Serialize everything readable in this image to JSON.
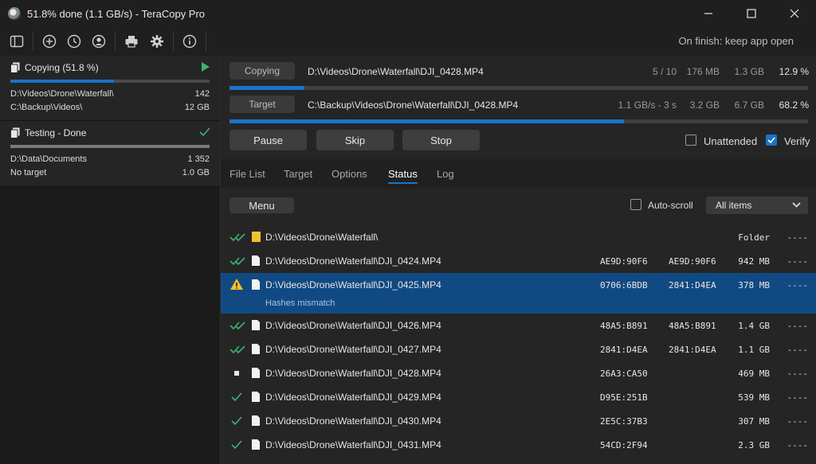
{
  "window": {
    "title": "51.8% done (1.1 GB/s) - TeraCopy Pro"
  },
  "toolbar": {
    "on_finish": "On finish: keep app open"
  },
  "jobs": [
    {
      "title": "Copying (51.8 %)",
      "progress": 0.518,
      "source": "D:\\Videos\\Drone\\Waterfall\\",
      "source_count": "142",
      "target": "C:\\Backup\\Videos\\",
      "target_size": "12 GB"
    },
    {
      "title": "Testing - Done",
      "progress": 1.0,
      "source": "D:\\Data\\Documents",
      "source_count": "1 352",
      "target": "No target",
      "target_size": "1.0 GB"
    }
  ],
  "current": {
    "copying_label": "Copying",
    "copying_path": "D:\\Videos\\Drone\\Waterfall\\DJI_0428.MP4",
    "files": "5 / 10",
    "done_size": "176 MB",
    "total_size": "1.3 GB",
    "file_percent": "12.9 %",
    "file_progress": 0.129,
    "target_label": "Target",
    "target_path": "C:\\Backup\\Videos\\Drone\\Waterfall\\DJI_0428.MP4",
    "speed": "1.1 GB/s - 3 s",
    "total_done": "3.2 GB",
    "total_all": "6.7 GB",
    "total_percent": "68.2 %",
    "total_progress": 0.682
  },
  "buttons": {
    "pause": "Pause",
    "skip": "Skip",
    "stop": "Stop"
  },
  "options": {
    "unattended": "Unattended",
    "verify": "Verify"
  },
  "tabs": [
    "File List",
    "Target",
    "Options",
    "Status",
    "Log"
  ],
  "status_bar": {
    "menu": "Menu",
    "autoscroll": "Auto-scroll",
    "filter": "All items"
  },
  "rows": [
    {
      "status": "double-check",
      "type": "folder",
      "path": "D:\\Videos\\Drone\\Waterfall\\",
      "hash1": "",
      "hash2": "",
      "size": "Folder",
      "extra": "----"
    },
    {
      "status": "double-check",
      "type": "file",
      "path": "D:\\Videos\\Drone\\Waterfall\\DJI_0424.MP4",
      "hash1": "AE9D:90F6",
      "hash2": "AE9D:90F6",
      "size": "942 MB",
      "extra": "----"
    },
    {
      "status": "warning",
      "type": "file",
      "path": "D:\\Videos\\Drone\\Waterfall\\DJI_0425.MP4",
      "hash1": "0706:6BDB",
      "hash2": "2841:D4EA",
      "size": "378 MB",
      "extra": "----",
      "note": "Hashes mismatch"
    },
    {
      "status": "double-check",
      "type": "file",
      "path": "D:\\Videos\\Drone\\Waterfall\\DJI_0426.MP4",
      "hash1": "48A5:B891",
      "hash2": "48A5:B891",
      "size": "1.4 GB",
      "extra": "----"
    },
    {
      "status": "double-check",
      "type": "file",
      "path": "D:\\Videos\\Drone\\Waterfall\\DJI_0427.MP4",
      "hash1": "2841:D4EA",
      "hash2": "2841:D4EA",
      "size": "1.1 GB",
      "extra": "----"
    },
    {
      "status": "in-progress",
      "type": "file",
      "path": "D:\\Videos\\Drone\\Waterfall\\DJI_0428.MP4",
      "hash1": "26A3:CA50",
      "hash2": "",
      "size": "469 MB",
      "extra": "----"
    },
    {
      "status": "check",
      "type": "file",
      "path": "D:\\Videos\\Drone\\Waterfall\\DJI_0429.MP4",
      "hash1": "D95E:251B",
      "hash2": "",
      "size": "539 MB",
      "extra": "----"
    },
    {
      "status": "check",
      "type": "file",
      "path": "D:\\Videos\\Drone\\Waterfall\\DJI_0430.MP4",
      "hash1": "2E5C:37B3",
      "hash2": "",
      "size": "307 MB",
      "extra": "----"
    },
    {
      "status": "check",
      "type": "file",
      "path": "D:\\Videos\\Drone\\Waterfall\\DJI_0431.MP4",
      "hash1": "54CD:2F94",
      "hash2": "",
      "size": "2.3 GB",
      "extra": "----"
    }
  ],
  "colors": {
    "accent": "#1a73c8",
    "selected_row": "#114a83",
    "ok_green": "#3cb371",
    "warning": "#f2c12e"
  }
}
